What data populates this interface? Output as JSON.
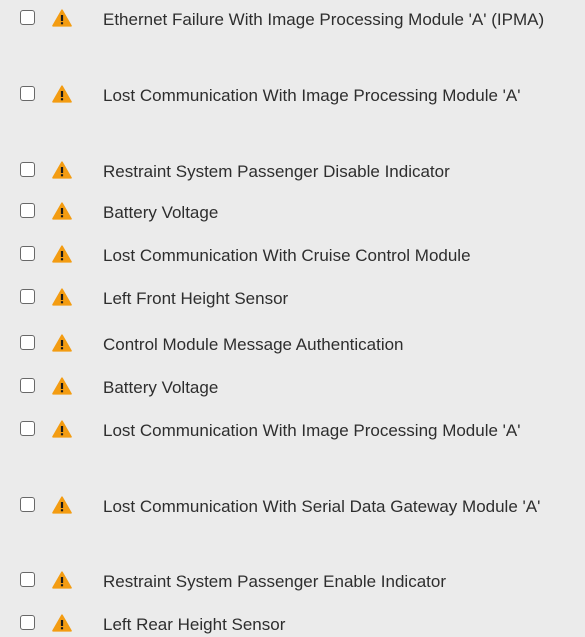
{
  "colors": {
    "background": "#ebebeb",
    "text": "#2e2e2e",
    "checkbox_border": "#686868",
    "warning_fill": "#f39c12",
    "warning_glyph": "#1a1a1a"
  },
  "icon_names": {
    "checkbox": "checkbox-unchecked",
    "status": "warning-triangle-icon"
  },
  "issues": [
    {
      "label": "Ethernet Failure With Image Processing Module 'A' (IPMA)",
      "checked": false
    },
    {
      "label": "Lost Communication With Image Processing Module 'A'",
      "checked": false
    },
    {
      "label": "Restraint System Passenger Disable Indicator",
      "checked": false
    },
    {
      "label": "Battery Voltage",
      "checked": false
    },
    {
      "label": "Lost Communication With Cruise Control Module",
      "checked": false
    },
    {
      "label": "Left Front Height Sensor",
      "checked": false
    },
    {
      "label": "Control Module Message Authentication",
      "checked": false
    },
    {
      "label": "Battery Voltage",
      "checked": false
    },
    {
      "label": "Lost Communication With Image Processing Module 'A'",
      "checked": false
    },
    {
      "label": "Lost Communication With Serial Data Gateway Module 'A'",
      "checked": false
    },
    {
      "label": "Restraint System Passenger Enable Indicator",
      "checked": false
    },
    {
      "label": "Left Rear Height Sensor",
      "checked": false
    }
  ]
}
